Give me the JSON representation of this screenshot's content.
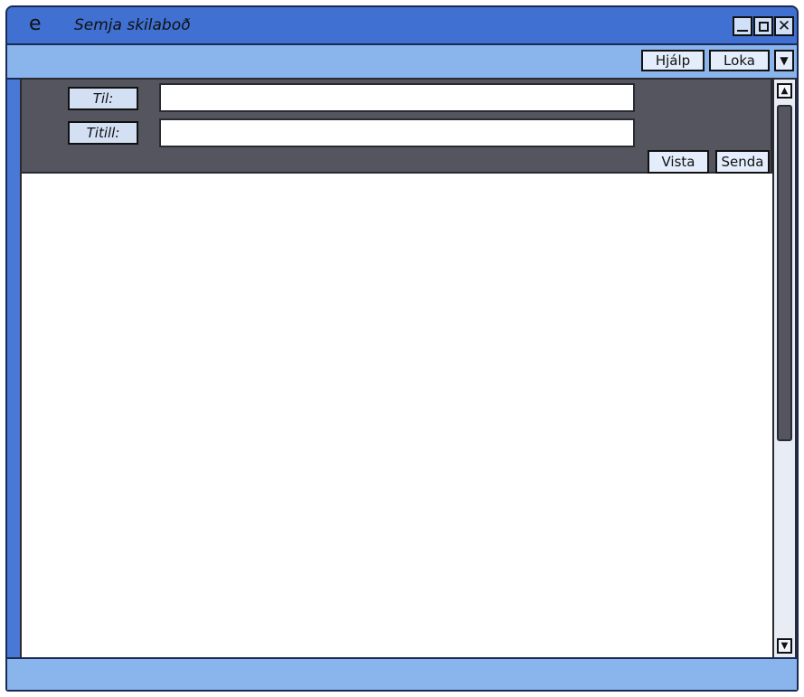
{
  "window": {
    "icon": "e",
    "title": "Semja skilaboð"
  },
  "window_controls": {
    "minimize_icon": "minimize-icon",
    "maximize_icon": "maximize-icon",
    "close_icon": "close-icon",
    "close_glyph": "✕"
  },
  "toolbar": {
    "help_label": "Hjálp",
    "close_label": "Loka",
    "dropdown_glyph": "▼"
  },
  "header": {
    "to_label": "Til:",
    "to_value": "",
    "subject_label": "Titill:",
    "subject_value": "",
    "preview_label": "Vista",
    "send_label": "Senda"
  },
  "body": {
    "value": ""
  },
  "scrollbar": {
    "up_glyph": "▲",
    "down_glyph": "▼"
  },
  "colors": {
    "window_frame": "#4a78d6",
    "toolbar": "#8ab4ec",
    "header_panel": "#555560",
    "button_face": "#e3edfb"
  }
}
